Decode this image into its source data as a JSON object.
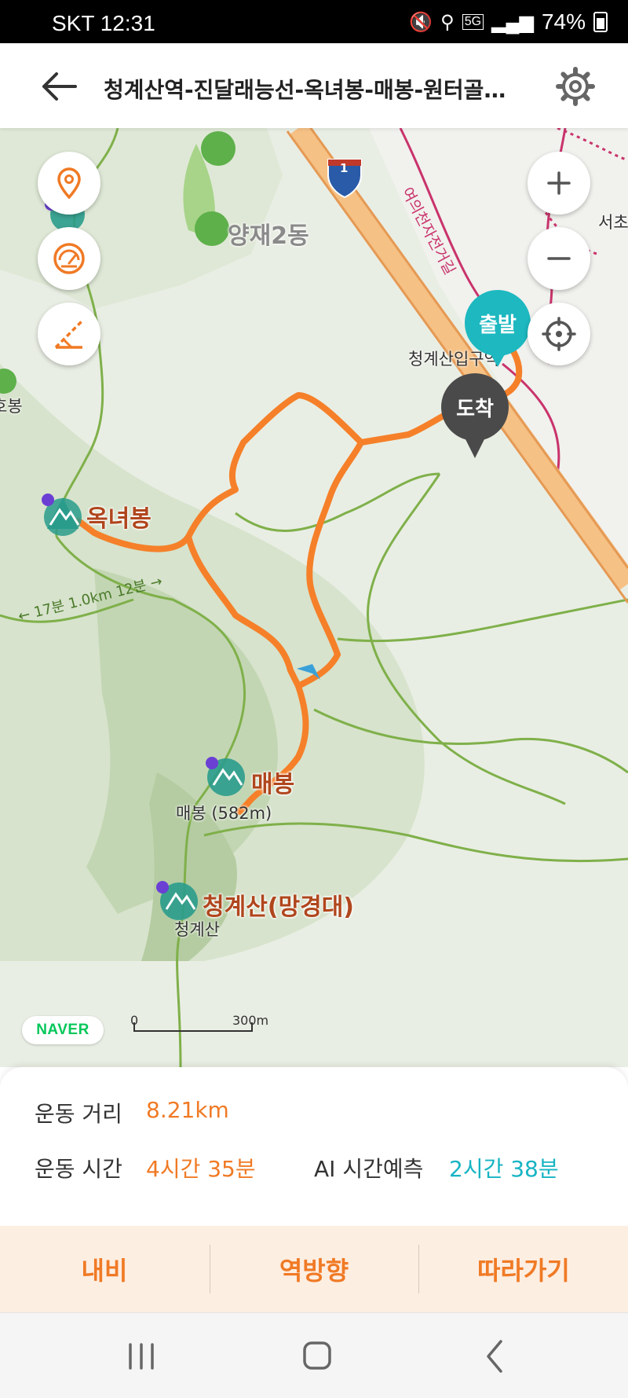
{
  "status_bar": {
    "carrier_time": "SKT 12:31",
    "network": "5G",
    "battery": "74%"
  },
  "header": {
    "title": "청계산역-진달래능선-옥녀봉-매봉-원터골…",
    "back_icon": "arrow-left-icon",
    "settings_icon": "gear-icon"
  },
  "map": {
    "labels": {
      "yangjae": "양재2동",
      "oknyeobong": "옥녀봉",
      "maebong": "매봉",
      "maebong_elev": "매봉 (582m)",
      "cheonggyesan": "청계산(망경대)",
      "cheonggyesan_small": "청계산",
      "station": "청계산입구역",
      "road_name": "여의천자전거길",
      "seocho": "서초",
      "left_peak": "호봉",
      "trail_note": "← 17분 1.0km 12분 →",
      "highway_number": "1"
    },
    "markers": {
      "start": "출발",
      "end": "도착"
    },
    "scale": {
      "zero": "0",
      "distance": "300m"
    },
    "logo": "NAVER",
    "controls": [
      "location-pin-icon",
      "speedometer-icon",
      "ruler-icon",
      "zoom-in-icon",
      "zoom-out-icon",
      "crosshair-icon"
    ],
    "route_color": "#f58029",
    "start_color": "#1db8c0",
    "end_color": "#4a4a4a"
  },
  "info": {
    "distance_label": "운동 거리",
    "distance_value": "8.21km",
    "time_label": "운동 시간",
    "time_value": "4시간 35분",
    "ai_label": "AI 시간예측",
    "ai_value": "2시간 38분"
  },
  "actions": {
    "navigate": "내비",
    "reverse": "역방향",
    "follow": "따라가기"
  }
}
